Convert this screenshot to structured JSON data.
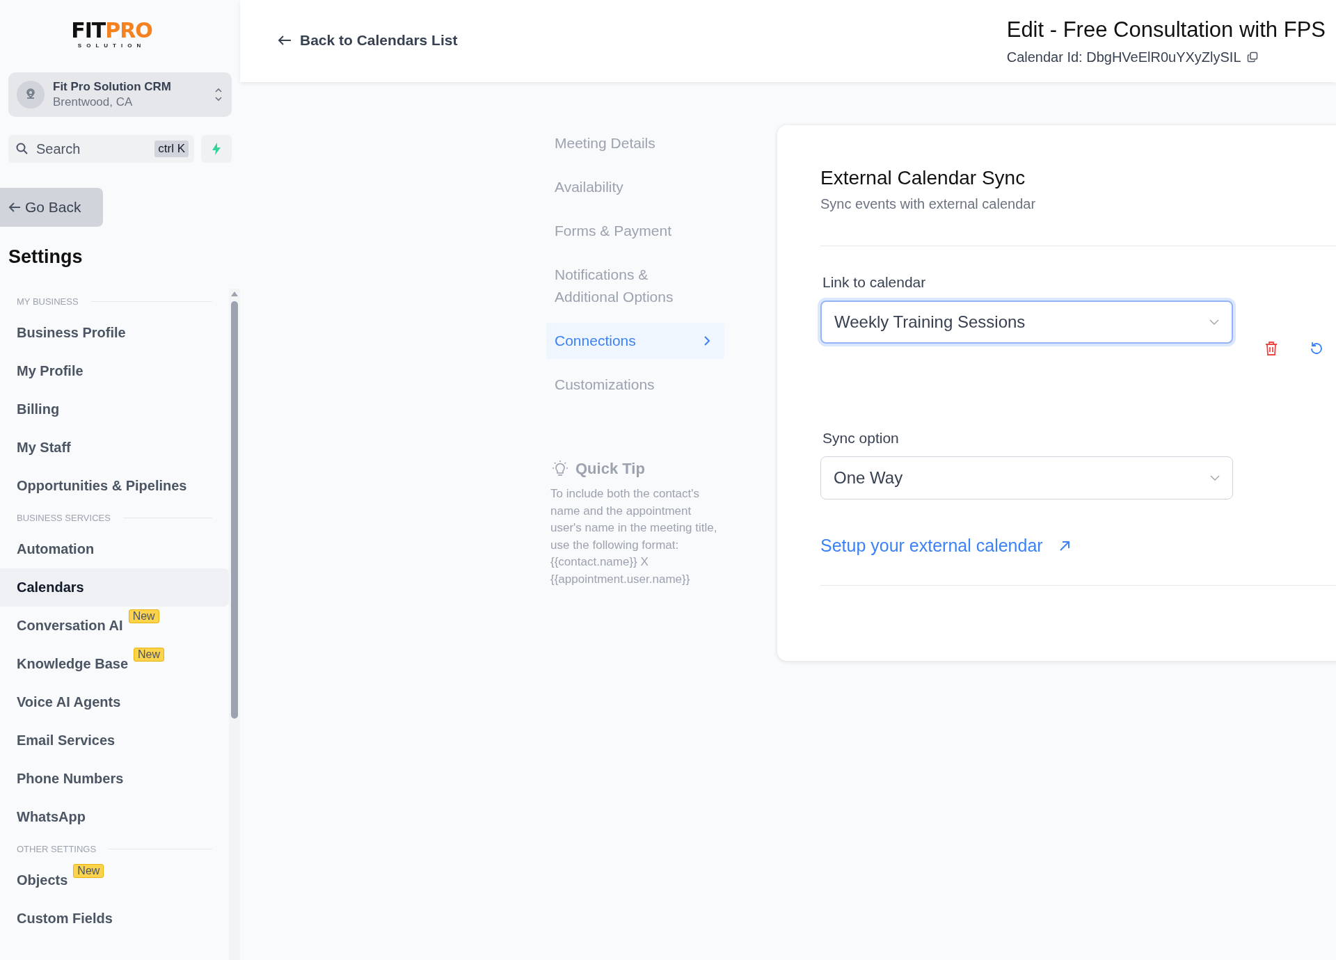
{
  "logo": {
    "word_1": "FIT",
    "word_2": "PRO",
    "tagline": "SOLUTION"
  },
  "account": {
    "name": "Fit Pro Solution CRM",
    "location": "Brentwood, CA"
  },
  "search": {
    "placeholder": "Search",
    "shortcut": "ctrl K"
  },
  "go_back": "Go Back",
  "sidebar": {
    "title": "Settings",
    "sections": [
      {
        "heading": "MY BUSINESS",
        "items": [
          {
            "label": "Business Profile",
            "selected": false
          },
          {
            "label": "My Profile",
            "selected": false
          },
          {
            "label": "Billing",
            "selected": false
          },
          {
            "label": "My Staff",
            "selected": false
          },
          {
            "label": "Opportunities & Pipelines",
            "selected": false
          }
        ]
      },
      {
        "heading": "BUSINESS SERVICES",
        "items": [
          {
            "label": "Automation",
            "selected": false
          },
          {
            "label": "Calendars",
            "selected": true
          },
          {
            "label": "Conversation AI",
            "selected": false,
            "badge": "New"
          },
          {
            "label": "Knowledge Base",
            "selected": false,
            "badge": "New"
          },
          {
            "label": "Voice AI Agents",
            "selected": false
          },
          {
            "label": "Email Services",
            "selected": false
          },
          {
            "label": "Phone Numbers",
            "selected": false
          },
          {
            "label": "WhatsApp",
            "selected": false
          }
        ]
      },
      {
        "heading": "OTHER SETTINGS",
        "items": [
          {
            "label": "Objects",
            "selected": false,
            "badge": "New"
          },
          {
            "label": "Custom Fields",
            "selected": false
          }
        ]
      }
    ]
  },
  "header": {
    "back_link": "Back to Calendars List",
    "title": "Edit - Free Consultation with FPS",
    "calendar_id": "Calendar Id: DbgHVeElR0uYXyZlySIL"
  },
  "nav": {
    "items": [
      {
        "label": "Meeting Details",
        "selected": false
      },
      {
        "label": "Availability",
        "selected": false
      },
      {
        "label": "Forms & Payment",
        "selected": false
      },
      {
        "label": "Notifications & Additional Options",
        "selected": false
      },
      {
        "label": "Connections",
        "selected": true
      },
      {
        "label": "Customizations",
        "selected": false
      }
    ]
  },
  "quick_tip": {
    "title": "Quick Tip",
    "text": "To include both the contact's name and the appointment user's name in the meeting title, use the following format: {{contact.name}} X {{appointment.user.name}}"
  },
  "card": {
    "title": "External Calendar Sync",
    "subtitle": "Sync events with external calendar",
    "fields": [
      {
        "label": "Link to calendar",
        "value": "Weekly Training Sessions",
        "focused": true,
        "actions": true
      },
      {
        "label": "Sync option",
        "value": "One Way",
        "focused": false
      }
    ],
    "link": "Setup your external calendar"
  }
}
